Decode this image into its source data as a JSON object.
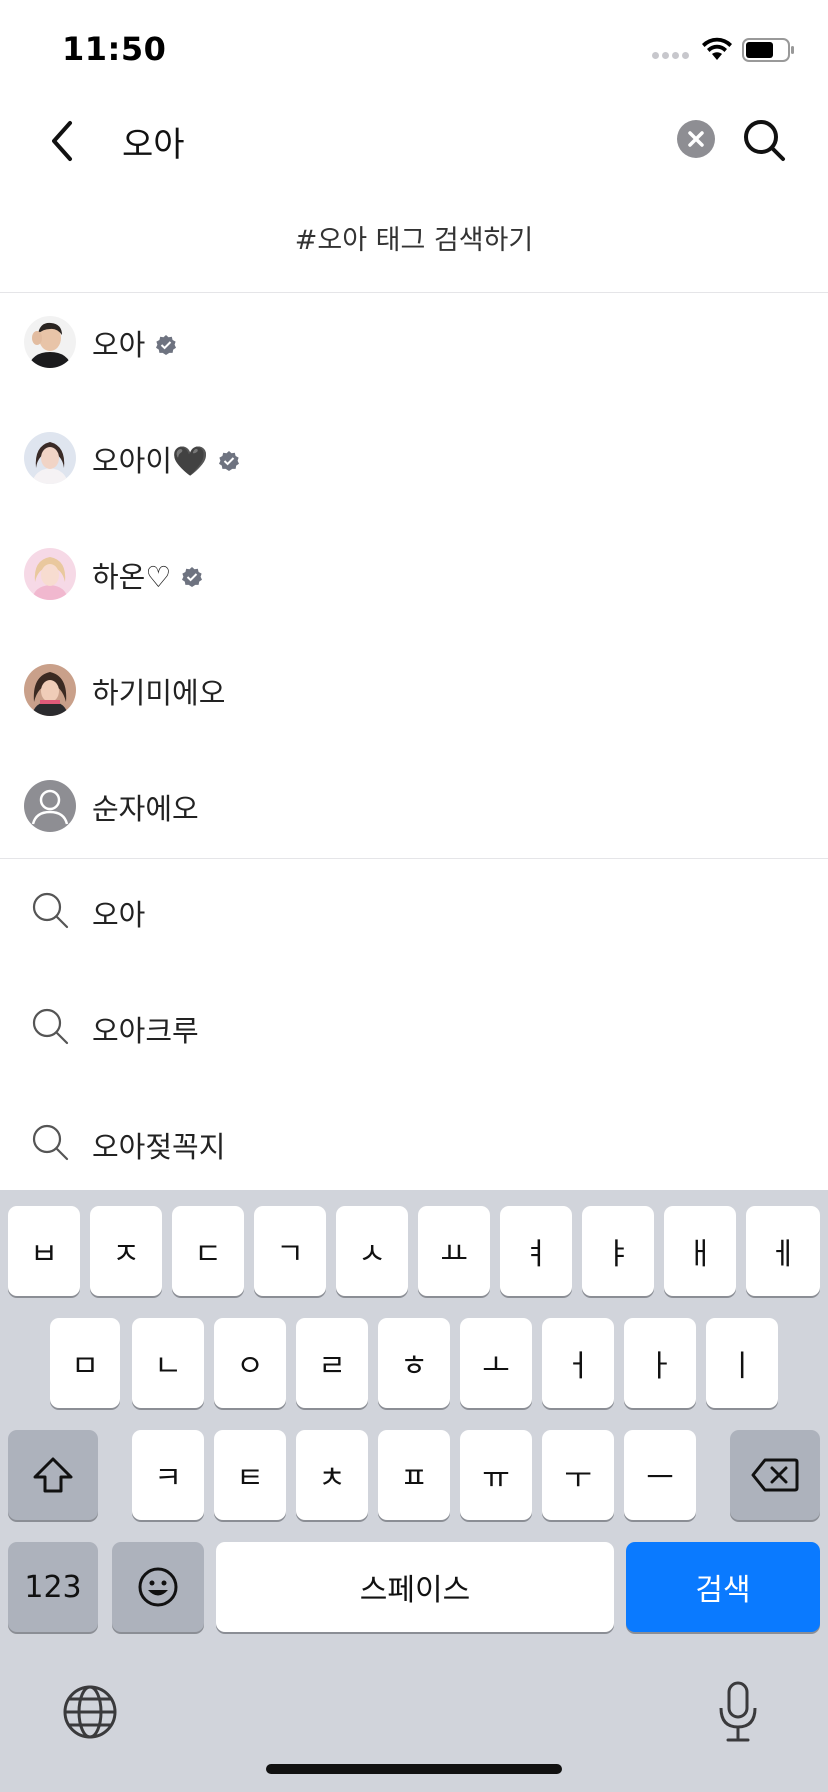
{
  "status_bar": {
    "time": "11:50"
  },
  "search": {
    "query": "오아",
    "tag_search_label": "#오아 태그 검색하기"
  },
  "users": [
    {
      "name": "오아",
      "verified": true,
      "avatar": "photo"
    },
    {
      "name": "오아이🖤",
      "verified": true,
      "avatar": "photo"
    },
    {
      "name": "하온♡",
      "verified": true,
      "avatar": "photo"
    },
    {
      "name": "하기미에오",
      "verified": false,
      "avatar": "photo"
    },
    {
      "name": "순자에오",
      "verified": false,
      "avatar": "default-person"
    }
  ],
  "keywords": [
    {
      "label": "오아"
    },
    {
      "label": "오아크루"
    },
    {
      "label": "오아젖꼭지"
    }
  ],
  "keyboard": {
    "row1": [
      "ㅂ",
      "ㅈ",
      "ㄷ",
      "ㄱ",
      "ㅅ",
      "ㅛ",
      "ㅕ",
      "ㅑ",
      "ㅐ",
      "ㅔ"
    ],
    "row2": [
      "ㅁ",
      "ㄴ",
      "ㅇ",
      "ㄹ",
      "ㅎ",
      "ㅗ",
      "ㅓ",
      "ㅏ",
      "ㅣ"
    ],
    "row3": [
      "ㅋ",
      "ㅌ",
      "ㅊ",
      "ㅍ",
      "ㅠ",
      "ㅜ",
      "ㅡ"
    ],
    "numbers_label": "123",
    "space_label": "스페이스",
    "search_label": "검색",
    "icons": [
      "shift-icon",
      "backspace-icon",
      "emoji-icon",
      "globe-icon",
      "microphone-icon"
    ]
  },
  "colors": {
    "accent": "#0a7aff",
    "keyboard_bg": "#d1d4db",
    "verified": "#6e7380"
  }
}
